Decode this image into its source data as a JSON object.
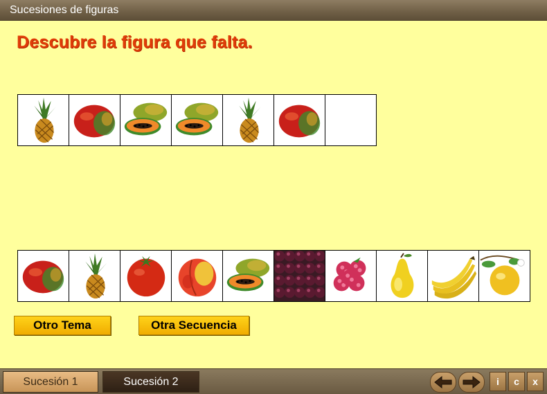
{
  "window": {
    "title": "Sucesiones de figuras"
  },
  "exercise": {
    "instruction": "Descubre la figura que falta.",
    "sequence": [
      {
        "fruit": "pineapple-icon"
      },
      {
        "fruit": "mango-icon"
      },
      {
        "fruit": "papaya-icon"
      },
      {
        "fruit": "papaya-icon"
      },
      {
        "fruit": "pineapple-icon"
      },
      {
        "fruit": "mango-icon"
      },
      {
        "fruit": "empty-slot"
      }
    ],
    "options": [
      {
        "fruit": "mango-icon"
      },
      {
        "fruit": "pineapple-icon"
      },
      {
        "fruit": "tomato-icon"
      },
      {
        "fruit": "peach-icon"
      },
      {
        "fruit": "papaya-icon"
      },
      {
        "fruit": "blackberries-icon"
      },
      {
        "fruit": "raspberries-icon"
      },
      {
        "fruit": "pear-icon"
      },
      {
        "fruit": "bananas-icon"
      },
      {
        "fruit": "lemon-icon"
      }
    ]
  },
  "buttons": {
    "otro_tema": "Otro Tema",
    "otra_secuencia": "Otra Secuencia"
  },
  "footer": {
    "tab1": "Sucesión 1",
    "tab2": "Sucesión 2",
    "info": "i",
    "credits": "c",
    "close": "x"
  }
}
